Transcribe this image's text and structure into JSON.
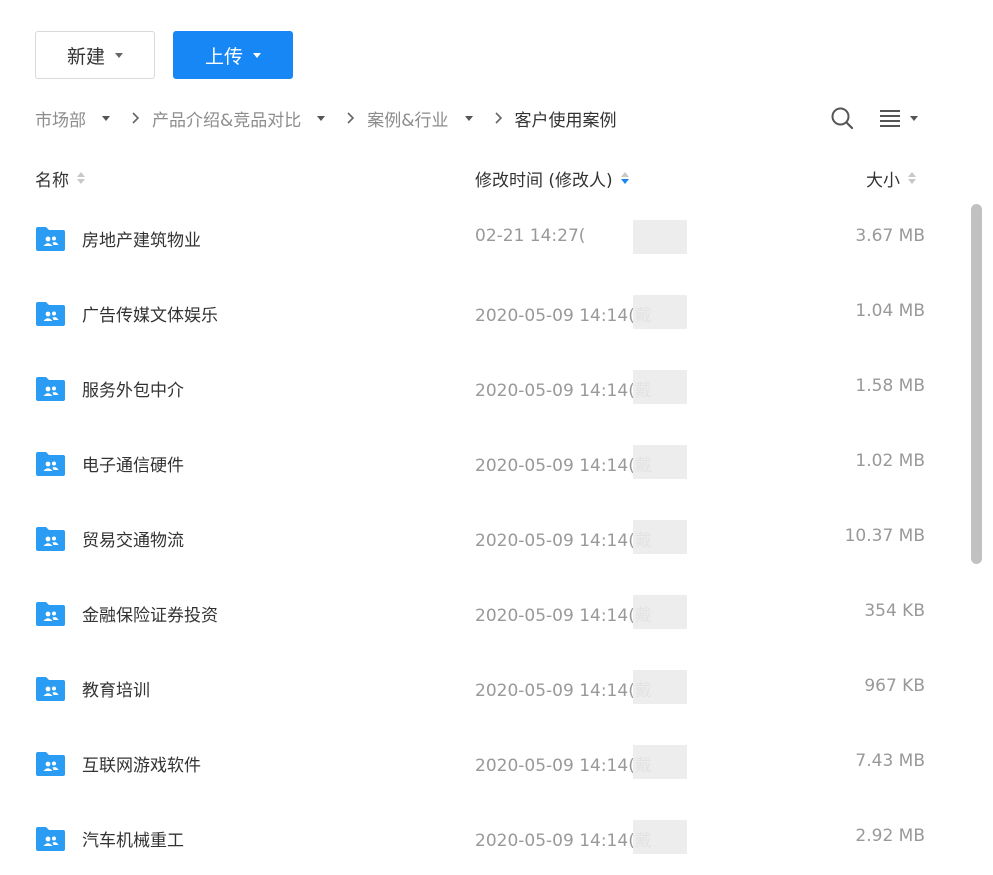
{
  "toolbar": {
    "new_label": "新建",
    "upload_label": "上传"
  },
  "breadcrumb": [
    {
      "label": "市场部",
      "dropdown": true
    },
    {
      "label": "产品介绍&竞品对比",
      "dropdown": true
    },
    {
      "label": "案例&行业",
      "dropdown": true
    },
    {
      "label": "客户使用案例",
      "dropdown": false
    }
  ],
  "table": {
    "columns": {
      "name": "名称",
      "modified": "修改时间 (修改人)",
      "size": "大小"
    },
    "rows": [
      {
        "name": "房地产建筑物业",
        "modified": "02-21 14:27(",
        "size": "3.67 MB"
      },
      {
        "name": "广告传媒文体娱乐",
        "modified": "2020-05-09 14:14(戴",
        "size": "1.04 MB"
      },
      {
        "name": "服务外包中介",
        "modified": "2020-05-09 14:14(戴",
        "size": "1.58 MB"
      },
      {
        "name": "电子通信硬件",
        "modified": "2020-05-09 14:14(戴",
        "size": "1.02 MB"
      },
      {
        "name": "贸易交通物流",
        "modified": "2020-05-09 14:14(戴",
        "size": "10.37 MB"
      },
      {
        "name": "金融保险证券投资",
        "modified": "2020-05-09 14:14(戴",
        "size": "354 KB"
      },
      {
        "name": "教育培训",
        "modified": "2020-05-09 14:14(戴",
        "size": "967 KB"
      },
      {
        "name": "互联网游戏软件",
        "modified": "2020-05-09 14:14(戴",
        "size": "7.43 MB"
      },
      {
        "name": "汽车机械重工",
        "modified": "2020-05-09 14:14(戴",
        "size": "2.92 MB"
      }
    ]
  },
  "colors": {
    "accent": "#1687f5",
    "folder": "#2a9cf3",
    "text": "#333333",
    "muted": "#999999"
  },
  "icons": {
    "folder": "shared-folder-icon",
    "search": "search-icon",
    "list": "list-view-icon"
  }
}
